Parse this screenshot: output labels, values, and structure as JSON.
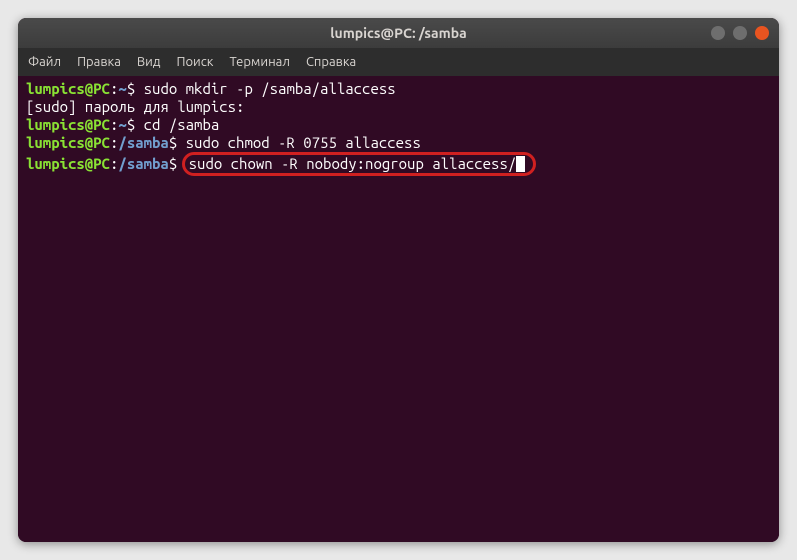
{
  "window": {
    "title": "lumpics@PC: /samba"
  },
  "menu": {
    "file": "Файл",
    "edit": "Правка",
    "view": "Вид",
    "search": "Поиск",
    "terminal": "Терминал",
    "help": "Справка"
  },
  "term": {
    "lines": [
      {
        "user": "lumpics@PC",
        "path": "~",
        "cmd": "sudo mkdir -p /samba/allaccess"
      },
      {
        "output": "[sudo] пароль для lumpics:"
      },
      {
        "user": "lumpics@PC",
        "path": "~",
        "cmd": "cd /samba"
      },
      {
        "user": "lumpics@PC",
        "path": "/samba",
        "cmd": "sudo chmod -R 0755 allaccess"
      },
      {
        "user": "lumpics@PC",
        "path": "/samba",
        "cmd": "sudo chown -R nobody:nogroup allaccess/",
        "highlight": true,
        "cursor": true
      }
    ],
    "sep": ":",
    "sym": "$"
  }
}
